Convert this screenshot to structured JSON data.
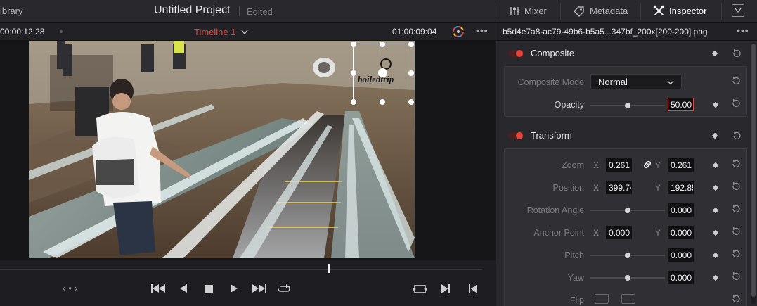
{
  "topbar": {
    "library_label": "ibrary",
    "project_title": "Untitled Project",
    "project_status": "Edited",
    "mixer_label": "Mixer",
    "metadata_label": "Metadata",
    "inspector_label": "Inspector"
  },
  "viewer": {
    "timecode_left": "00:00:12:28",
    "timeline_name": "Timeline 1",
    "timecode_right": "01:00:09:04",
    "playhead_position": 0.68,
    "overlay_watermark": "boiledtrip"
  },
  "inspector": {
    "file_name": "b5d4e7a8-ac79-49b6-b5a5...347bf_200x[200-200].png",
    "composite": {
      "title": "Composite",
      "mode_label": "Composite Mode",
      "mode_value": "Normal",
      "opacity_label": "Opacity",
      "opacity_value": "50.00",
      "opacity_level": 0.5
    },
    "transform": {
      "title": "Transform",
      "zoom_label": "Zoom",
      "zoom_x": "0.261",
      "zoom_y": "0.261",
      "position_label": "Position",
      "position_x": "399.74",
      "position_y": "192.85",
      "rotation_label": "Rotation Angle",
      "rotation_value": "0.000",
      "anchor_label": "Anchor Point",
      "anchor_x": "0.000",
      "anchor_y": "0.000",
      "pitch_label": "Pitch",
      "pitch_value": "0.000",
      "yaw_label": "Yaw",
      "yaw_value": "0.000",
      "flip_label": "Flip",
      "axis_x": "X",
      "axis_y": "Y"
    }
  },
  "colors": {
    "accent_red": "#e0483d",
    "panel": "#28282d",
    "field": "#111113"
  }
}
